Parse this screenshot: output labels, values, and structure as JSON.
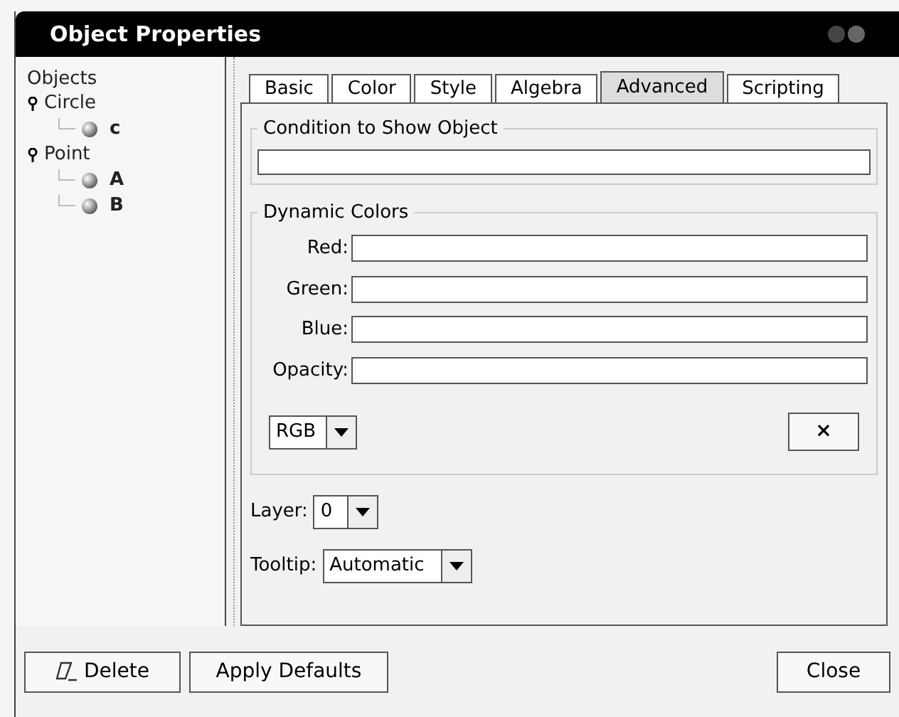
{
  "window": {
    "title": "Object Properties"
  },
  "tree": {
    "label": "Objects",
    "children": [
      {
        "label": "Circle",
        "expanded": true,
        "children": [
          {
            "label": "c"
          }
        ]
      },
      {
        "label": "Point",
        "expanded": true,
        "children": [
          {
            "label": "A"
          },
          {
            "label": "B"
          }
        ]
      }
    ]
  },
  "tabs": [
    {
      "label": "Basic",
      "selected": false
    },
    {
      "label": "Color",
      "selected": false
    },
    {
      "label": "Style",
      "selected": false
    },
    {
      "label": "Algebra",
      "selected": false
    },
    {
      "label": "Advanced",
      "selected": true
    },
    {
      "label": "Scripting",
      "selected": false
    }
  ],
  "condition": {
    "title": "Condition to Show Object"
  },
  "dynamic_colors": {
    "title": "Dynamic Colors",
    "fields": [
      {
        "label": "Red:"
      },
      {
        "label": "Green:"
      },
      {
        "label": "Blue:"
      },
      {
        "label": "Opacity:"
      }
    ],
    "mode": "RGB",
    "clear_button": "×"
  },
  "layer": {
    "label": "Layer:",
    "value": "0"
  },
  "tooltip": {
    "label": "Tooltip:",
    "value": "Automatic"
  },
  "buttons": {
    "delete": "Delete",
    "apply": "Apply Defaults",
    "close": "Close"
  }
}
